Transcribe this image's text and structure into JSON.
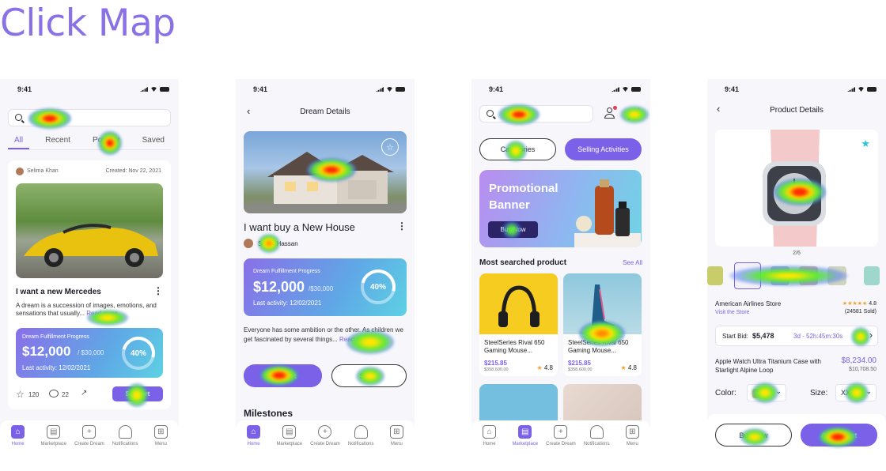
{
  "page_title": "Click Map",
  "status_time": "9:41",
  "nav": {
    "home": "Home",
    "marketplace": "Marketplace",
    "create": "Create Dream",
    "notifications": "Notifications",
    "menu": "Menu"
  },
  "screen1": {
    "tabs": [
      "All",
      "Recent",
      "Popular",
      "Saved"
    ],
    "author": "Selima Khan",
    "created": "Created: Nov 22, 2021",
    "card_title": "I want a new Mercedes",
    "card_desc": "A dream is a succession of images, emotions, and sensations that usually...",
    "read_more": "Read more",
    "progress_label": "Dream Fulfillment Progress",
    "amount": "$12,000",
    "amount_goal": "/ $30,000",
    "last_activity": "Last activity: 12/02/2021",
    "percent": "40%",
    "likes": "120",
    "comments": "22",
    "support": "Support"
  },
  "screen2": {
    "header": "Dream Details",
    "title": "I want buy a New House",
    "author": "Sarah Hassan",
    "progress_label": "Dream Fulfillment Progress",
    "amount": "$12,000",
    "amount_goal": "/$30,000",
    "last_activity": "Last activity: 12/02/2021",
    "percent": "40%",
    "desc": "Everyone has some ambition or the other. As children we get fascinated by several things...",
    "read_more": "Read more",
    "support": "Support",
    "share": "Share",
    "milestones": "Milestones"
  },
  "screen3": {
    "categories": "Categories",
    "selling": "Selling Activities",
    "banner_title": "Promotional Banner",
    "buy_now": "Buy Now",
    "section": "Most searched product",
    "see_all": "See All",
    "products": [
      {
        "name": "SteelSeries Rival 650 Gaming Mouse...",
        "price": "$215.85",
        "old": "$358,600.00",
        "rating": "4.8"
      },
      {
        "name": "SteelSeries Rival 650 Gaming Mouse...",
        "price": "$215.85",
        "old": "$358,600.00",
        "rating": "4.8"
      }
    ]
  },
  "screen4": {
    "header": "Product Details",
    "pager": "2/6",
    "store": "American Airlines Store",
    "visit": "Visit the Store",
    "rating": "4.8",
    "sold": "(24581 Sold)",
    "bid_label": "Start Bid:",
    "bid_value": "$5,478",
    "bid_time": "3d - 52h:45m:30s",
    "product": "Apple Watch Ultra Titanium Case with Starlight Alpine Loop",
    "price": "$8,234.00",
    "old_price": "$10,708.50",
    "color_label": "Color:",
    "size_label": "Size:",
    "size_value": "XXL",
    "buy_now": "Buy Now",
    "add_cart": "Add to Cart"
  },
  "colors": {
    "accent": "#7b61e8",
    "title": "#8a72e6"
  }
}
